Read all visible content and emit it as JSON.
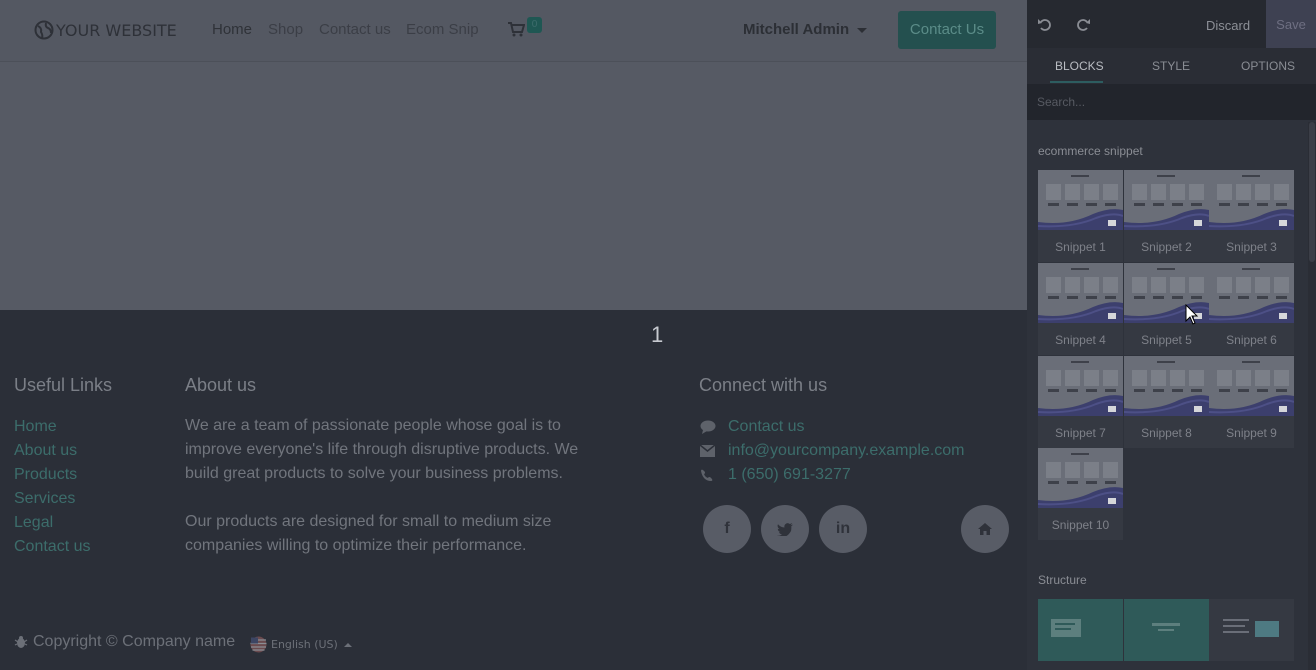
{
  "navbar": {
    "brand": "YOUR WEBSITE",
    "links": [
      "Home",
      "Shop",
      "Contact us",
      "Ecom Snip"
    ],
    "cart_count": "0",
    "user": "Mitchell Admin",
    "cta": "Contact Us"
  },
  "footer": {
    "page_number": "1",
    "useful_links": {
      "title": "Useful Links",
      "items": [
        "Home",
        "About us",
        "Products",
        "Services",
        "Legal",
        "Contact us"
      ]
    },
    "about": {
      "title": "About us",
      "p1": "We are a team of passionate people whose goal is to improve everyone's life through disruptive products. We build great products to solve your business problems.",
      "p2": "Our products are designed for small to medium size companies willing to optimize their performance."
    },
    "connect": {
      "title": "Connect with us",
      "contact": "Contact us",
      "email": "info@yourcompany.example.com",
      "phone": "1 (650) 691-3277"
    },
    "copyright": "Copyright © Company name",
    "language": "English (US)"
  },
  "panel": {
    "discard": "Discard",
    "save": "Save",
    "tabs": [
      "BLOCKS",
      "STYLE",
      "OPTIONS"
    ],
    "search_placeholder": "Search...",
    "ecommerce_group": "ecommerce snippet",
    "snippets": [
      "Snippet 1",
      "Snippet 2",
      "Snippet 3",
      "Snippet 4",
      "Snippet 5",
      "Snippet 6",
      "Snippet 7",
      "Snippet 8",
      "Snippet 9",
      "Snippet 10"
    ],
    "structure_group": "Structure"
  },
  "icons": {
    "brand": "globe-icon",
    "cart": "cart-icon",
    "undo": "undo-icon",
    "redo": "redo-icon",
    "chat": "comment-icon",
    "email": "envelope-icon",
    "phone": "phone-icon",
    "facebook": "facebook-icon",
    "twitter": "twitter-icon",
    "linkedin": "linkedin-icon",
    "home": "home-icon"
  },
  "colors": {
    "accent_teal": "#24504f",
    "link": "#3c6d6b",
    "overlay_site": "#565a64",
    "footer_bg": "#2b2f38",
    "panel_bg": "#2e323b"
  }
}
